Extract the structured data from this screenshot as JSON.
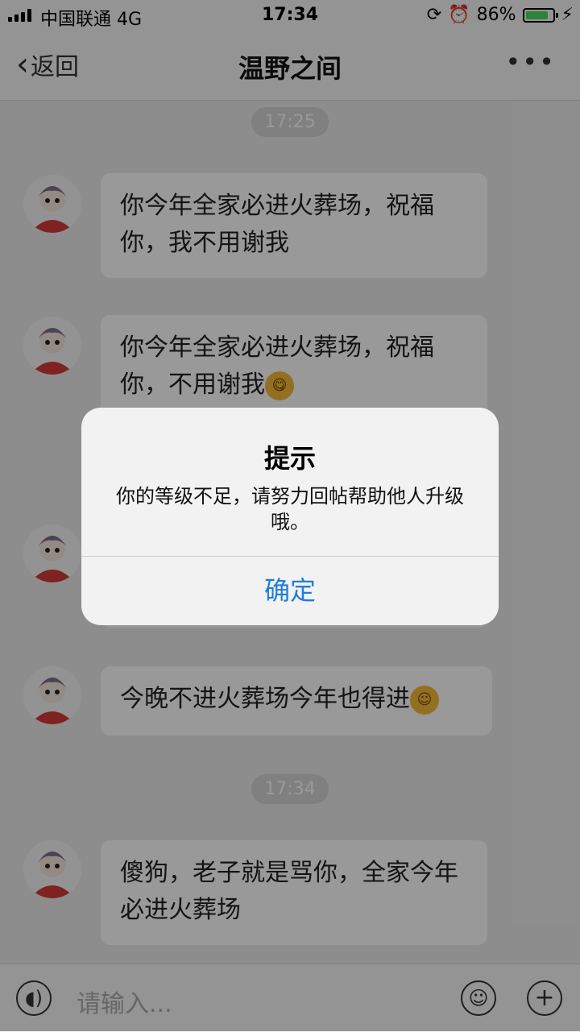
{
  "status": {
    "carrier": "中国联通  4G",
    "time": "17:34",
    "battery_text": "86%",
    "battery_level": 0.86
  },
  "nav": {
    "back_label": "返回",
    "title": "温野之间",
    "more_label": "•••"
  },
  "messages": {
    "time1": "17:25",
    "m1": "你今年全家必进火葬场，祝福你，我不用谢我",
    "m2": "你今年全家必进火葬场，祝福你，不用谢我",
    "m4": "今晚不进火葬场今年也得进",
    "time2": "17:34",
    "m5": "傻狗，老子就是骂你，全家今年必进火葬场"
  },
  "input": {
    "placeholder": "请输入..."
  },
  "alert": {
    "title": "提示",
    "message": "你的等级不足，请努力回帖帮助他人升级哦。",
    "button": "确定"
  },
  "colors": {
    "accent": "#1f7ed8",
    "battery": "#4cd964"
  },
  "icons": [
    "signal-icon",
    "alarm-icon",
    "rotation-lock-icon",
    "battery-icon",
    "charging-icon",
    "chevron-left-icon",
    "more-icon",
    "voice-icon",
    "emoji-icon",
    "plus-icon",
    "tongue-emoji-icon",
    "blush-emoji-icon"
  ]
}
